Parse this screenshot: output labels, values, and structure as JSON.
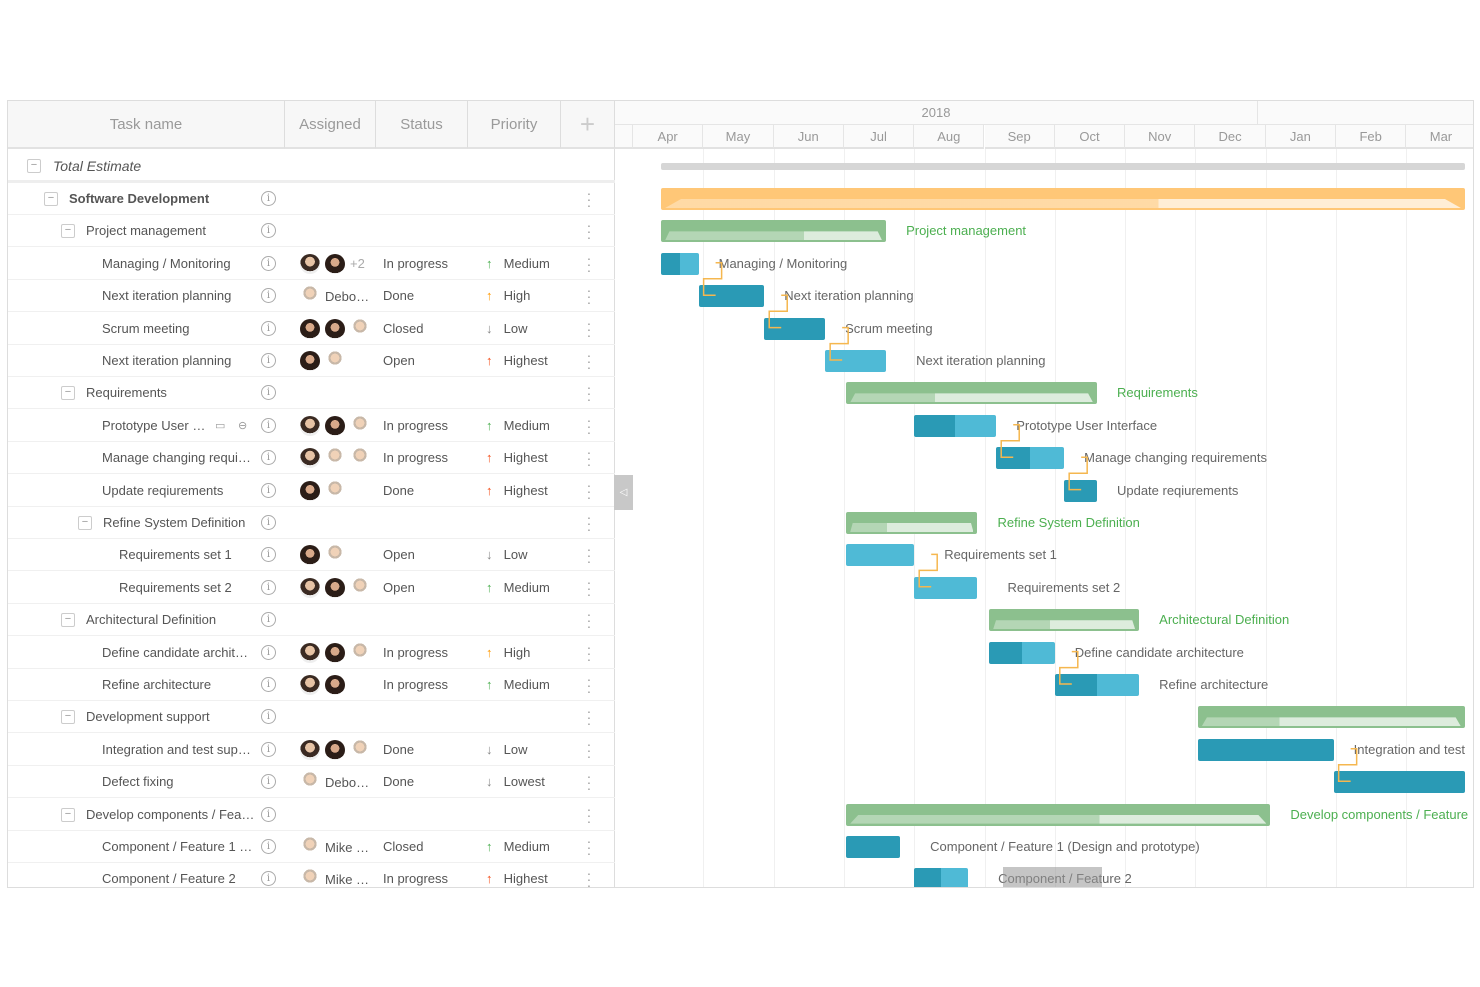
{
  "grid": {
    "columns": [
      "Task name",
      "Assigned",
      "Status",
      "Priority"
    ],
    "add_column_icon": "plus-icon"
  },
  "timeline": {
    "year": "2018",
    "months": [
      "Apr",
      "May",
      "Jun",
      "Jul",
      "Aug",
      "Sep",
      "Oct",
      "Nov",
      "Dec",
      "Jan",
      "Feb",
      "Mar"
    ]
  },
  "colors": {
    "task_dark": "#2a9ab5",
    "task_light": "#4fbad6",
    "summary": "#8cc08e",
    "summary_light": "#cfe6cf",
    "project": "#ffc777",
    "project_light": "#ffe6bf",
    "total": "#d6d6d6",
    "link": "#f5b74f",
    "summary_label": "#4caf50"
  },
  "priority_colors": {
    "Medium": "#4caf50",
    "High": "#ff9800",
    "Highest": "#f4511e",
    "Low": "#888888",
    "Lowest": "#888888"
  },
  "rows": [
    {
      "name": "Total Estimate",
      "level": 0,
      "kind": "total",
      "gantt": {
        "start": "2018-04-13",
        "end": "2019-03-26",
        "progress": 1
      }
    },
    {
      "name": "Software Development",
      "level": 1,
      "kind": "project",
      "gantt": {
        "start": "2018-04-13",
        "end": "2019-03-26",
        "progress": 0.62
      }
    },
    {
      "name": "Project management",
      "level": 2,
      "kind": "summary",
      "gantt": {
        "start": "2018-04-13",
        "end": "2018-07-19",
        "progress": 0.64,
        "label": "Project management"
      }
    },
    {
      "name": "Managing / Monitoring",
      "level": 3,
      "kind": "task",
      "avatars": [
        "a",
        "b"
      ],
      "assigned_text": "+2",
      "status": "In progress",
      "priority": "Medium",
      "dir": "up",
      "gantt": {
        "start": "2018-04-13",
        "end": "2018-04-29",
        "progress": 0.5,
        "label": "Managing / Monitoring"
      }
    },
    {
      "name": "Next iteration planning",
      "level": 3,
      "kind": "task",
      "avatars": [
        "c"
      ],
      "assigned_text": "Debo…",
      "status": "Done",
      "priority": "High",
      "dir": "up",
      "gantt": {
        "start": "2018-04-29",
        "end": "2018-05-27",
        "progress": 1,
        "label": "Next iteration planning"
      }
    },
    {
      "name": "Scrum meeting",
      "level": 3,
      "kind": "task",
      "avatars": [
        "b",
        "b",
        "c"
      ],
      "status": "Closed",
      "priority": "Low",
      "dir": "down",
      "gantt": {
        "start": "2018-05-27",
        "end": "2018-06-23",
        "progress": 1,
        "label": "Scrum meeting"
      }
    },
    {
      "name": "Next iteration planning",
      "level": 3,
      "kind": "task",
      "avatars": [
        "b",
        "c"
      ],
      "status": "Open",
      "priority": "Highest",
      "dir": "up",
      "gantt": {
        "start": "2018-06-23",
        "end": "2018-07-19",
        "progress": 0,
        "label": "Next iteration planning"
      }
    },
    {
      "name": "Requirements",
      "level": 2,
      "kind": "summary",
      "gantt": {
        "start": "2018-07-02",
        "end": "2018-10-19",
        "progress": 0.35,
        "label": "Requirements"
      }
    },
    {
      "name": "Prototype User …",
      "level": 3,
      "kind": "task",
      "extra_icons": true,
      "avatars": [
        "a",
        "b",
        "c"
      ],
      "status": "In progress",
      "priority": "Medium",
      "dir": "up",
      "gantt": {
        "start": "2018-08-01",
        "end": "2018-09-06",
        "progress": 0.5,
        "label": "Prototype User Interface"
      }
    },
    {
      "name": "Manage changing requi…",
      "level": 3,
      "kind": "task",
      "avatars": [
        "a",
        "c",
        "c"
      ],
      "status": "In progress",
      "priority": "Highest",
      "dir": "up",
      "gantt": {
        "start": "2018-09-06",
        "end": "2018-10-05",
        "progress": 0.5,
        "label": "Manage changing requirements"
      }
    },
    {
      "name": "Update reqiurements",
      "level": 3,
      "kind": "task",
      "avatars": [
        "b",
        "c"
      ],
      "status": "Done",
      "priority": "Highest",
      "dir": "up",
      "gantt": {
        "start": "2018-10-05",
        "end": "2018-10-19",
        "progress": 1,
        "label": "Update reqiurements"
      }
    },
    {
      "name": "Refine System Definition",
      "level": 3,
      "kind": "summary",
      "gantt": {
        "start": "2018-07-02",
        "end": "2018-08-28",
        "progress": 0.3,
        "label": "Refine System Definition"
      }
    },
    {
      "name": "Requirements set 1",
      "level": 4,
      "kind": "task",
      "avatars": [
        "b",
        "c"
      ],
      "status": "Open",
      "priority": "Low",
      "dir": "down",
      "gantt": {
        "start": "2018-07-02",
        "end": "2018-08-01",
        "progress": 0,
        "label": "Requirements set 1"
      }
    },
    {
      "name": "Requirements set 2",
      "level": 4,
      "kind": "task",
      "avatars": [
        "a",
        "b",
        "c"
      ],
      "status": "Open",
      "priority": "Medium",
      "dir": "up",
      "gantt": {
        "start": "2018-08-01",
        "end": "2018-08-28",
        "progress": 0,
        "label": "Requirements set 2"
      }
    },
    {
      "name": "Architectural Definition",
      "level": 2,
      "kind": "summary",
      "gantt": {
        "start": "2018-09-03",
        "end": "2018-11-07",
        "progress": 0.4,
        "label": "Architectural Definition"
      }
    },
    {
      "name": "Define candidate archit…",
      "level": 3,
      "kind": "task",
      "avatars": [
        "a",
        "b",
        "c"
      ],
      "status": "In progress",
      "priority": "High",
      "dir": "up",
      "gantt": {
        "start": "2018-09-03",
        "end": "2018-10-01",
        "progress": 0.5,
        "label": "Define candidate architecture"
      }
    },
    {
      "name": "Refine architecture",
      "level": 3,
      "kind": "task",
      "avatars": [
        "a",
        "b"
      ],
      "status": "In progress",
      "priority": "Medium",
      "dir": "up",
      "gantt": {
        "start": "2018-10-01",
        "end": "2018-11-07",
        "progress": 0.5,
        "label": "Refine architecture"
      }
    },
    {
      "name": "Development support",
      "level": 2,
      "kind": "summary",
      "gantt": {
        "start": "2018-12-02",
        "end": "2019-03-26",
        "progress": 0.3
      }
    },
    {
      "name": "Integration and test sup…",
      "level": 3,
      "kind": "task",
      "avatars": [
        "a",
        "b",
        "c"
      ],
      "status": "Done",
      "priority": "Low",
      "dir": "down",
      "gantt": {
        "start": "2018-12-02",
        "end": "2019-01-30",
        "progress": 1,
        "label": "Integration and test"
      }
    },
    {
      "name": "Defect fixing",
      "level": 3,
      "kind": "task",
      "avatars": [
        "c"
      ],
      "assigned_text": "Debo…",
      "status": "Done",
      "priority": "Lowest",
      "dir": "down",
      "gantt": {
        "start": "2019-01-30",
        "end": "2019-03-26",
        "progress": 1
      }
    },
    {
      "name": "Develop components / Fea…",
      "level": 2,
      "kind": "summary",
      "gantt": {
        "start": "2018-07-02",
        "end": "2019-01-03",
        "progress": 0.6,
        "label": "Develop components / Feature"
      }
    },
    {
      "name": "Component / Feature 1 …",
      "level": 3,
      "kind": "task",
      "avatars": [
        "c"
      ],
      "assigned_text": "Mike …",
      "status": "Closed",
      "priority": "Medium",
      "dir": "up",
      "gantt": {
        "start": "2018-07-02",
        "end": "2018-07-25",
        "progress": 1,
        "label": "Component / Feature 1 (Design and prototype)"
      }
    },
    {
      "name": "Component / Feature 2",
      "level": 3,
      "kind": "task",
      "avatars": [
        "c"
      ],
      "assigned_text": "Mike …",
      "status": "In progress",
      "priority": "Highest",
      "dir": "up",
      "gantt": {
        "start": "2018-08-01",
        "end": "2018-08-24",
        "progress": 0.5,
        "label": "Component / Feature 2"
      }
    }
  ],
  "links": [
    [
      3,
      4
    ],
    [
      4,
      5
    ],
    [
      5,
      6
    ],
    [
      8,
      9
    ],
    [
      9,
      10
    ],
    [
      12,
      13
    ],
    [
      15,
      16
    ],
    [
      18,
      19
    ]
  ]
}
